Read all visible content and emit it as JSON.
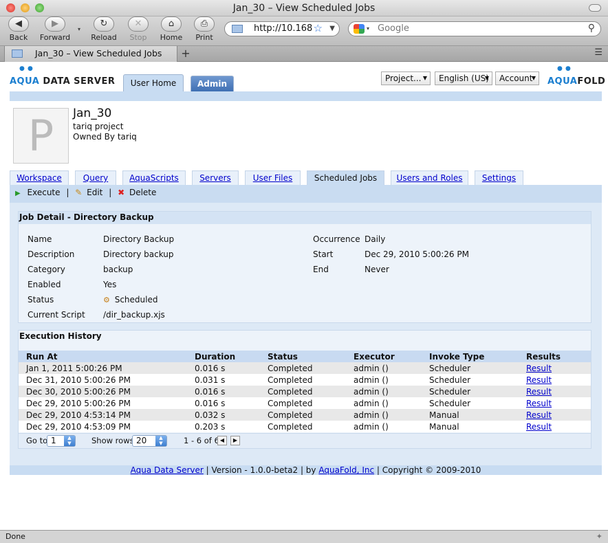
{
  "window": {
    "title": "Jan_30 – View Scheduled Jobs"
  },
  "toolbar": {
    "back": "Back",
    "forward": "Forward",
    "reload": "Reload",
    "stop": "Stop",
    "home": "Home",
    "print": "Print",
    "url": "http://10.168",
    "search_placeholder": "Google"
  },
  "tab": {
    "title": "Jan_30 – View Scheduled Jobs",
    "new_tab": "+"
  },
  "status": {
    "text": "Done"
  },
  "header": {
    "logo_left_a": "AQUA",
    "logo_left_b": "DATA SERVER",
    "logo_right_a": "AQUA",
    "logo_right_b": "FOLD",
    "tab_user_home": "User Home",
    "tab_admin": "Admin",
    "select_project": "Project...",
    "select_language": "English (US)",
    "select_account": "Account"
  },
  "project": {
    "name": "Jan_30",
    "subtitle": "tariq project",
    "owner": "Owned By tariq",
    "avatar_letter": "P"
  },
  "tabs": [
    "Workspace",
    "Query",
    "AquaScripts",
    "Servers",
    "User Files",
    "Scheduled Jobs",
    "Users and Roles",
    "Settings"
  ],
  "actions": {
    "execute": "Execute",
    "edit": "Edit",
    "delete": "Delete",
    "sep": "|"
  },
  "job": {
    "title": "Job Detail - Directory Backup",
    "fields": [
      {
        "label": "Name",
        "value": "Directory Backup"
      },
      {
        "label": "Description",
        "value": "Directory backup"
      },
      {
        "label": "Category",
        "value": "backup"
      },
      {
        "label": "Enabled",
        "value": "Yes"
      },
      {
        "label": "Status",
        "value": "Scheduled"
      },
      {
        "label": "Current Script",
        "value": "/dir_backup.xjs"
      }
    ],
    "right_fields": [
      {
        "label": "Occurrence",
        "value": "Daily"
      },
      {
        "label": "Start",
        "value": "Dec 29, 2010 5:00:26 PM"
      },
      {
        "label": "End",
        "value": "Never"
      }
    ]
  },
  "history": {
    "title": "Execution History",
    "columns": [
      "Run At",
      "Duration",
      "Status",
      "Executor",
      "Invoke Type",
      "Results"
    ],
    "rows": [
      [
        "Jan 1, 2011 5:00:26 PM",
        "0.016 s",
        "Completed",
        "admin ()",
        "Scheduler",
        "Result"
      ],
      [
        "Dec 31, 2010 5:00:26 PM",
        "0.031 s",
        "Completed",
        "admin ()",
        "Scheduler",
        "Result"
      ],
      [
        "Dec 30, 2010 5:00:26 PM",
        "0.016 s",
        "Completed",
        "admin ()",
        "Scheduler",
        "Result"
      ],
      [
        "Dec 29, 2010 5:00:26 PM",
        "0.016 s",
        "Completed",
        "admin ()",
        "Scheduler",
        "Result"
      ],
      [
        "Dec 29, 2010 4:53:14 PM",
        "0.032 s",
        "Completed",
        "admin ()",
        "Manual",
        "Result"
      ],
      [
        "Dec 29, 2010 4:53:09 PM",
        "0.203 s",
        "Completed",
        "admin ()",
        "Manual",
        "Result"
      ]
    ],
    "goto_label": "Go to",
    "goto_value": "1",
    "showrows_label": "Show rows",
    "showrows_value": "20",
    "range": "1 - 6 of 6"
  },
  "footer": {
    "link1": "Aqua Data Server",
    "text1": " | Version - 1.0.0-beta2 | by ",
    "link2": "AquaFold, Inc",
    "text2": " | Copyright © 2009-2010"
  }
}
